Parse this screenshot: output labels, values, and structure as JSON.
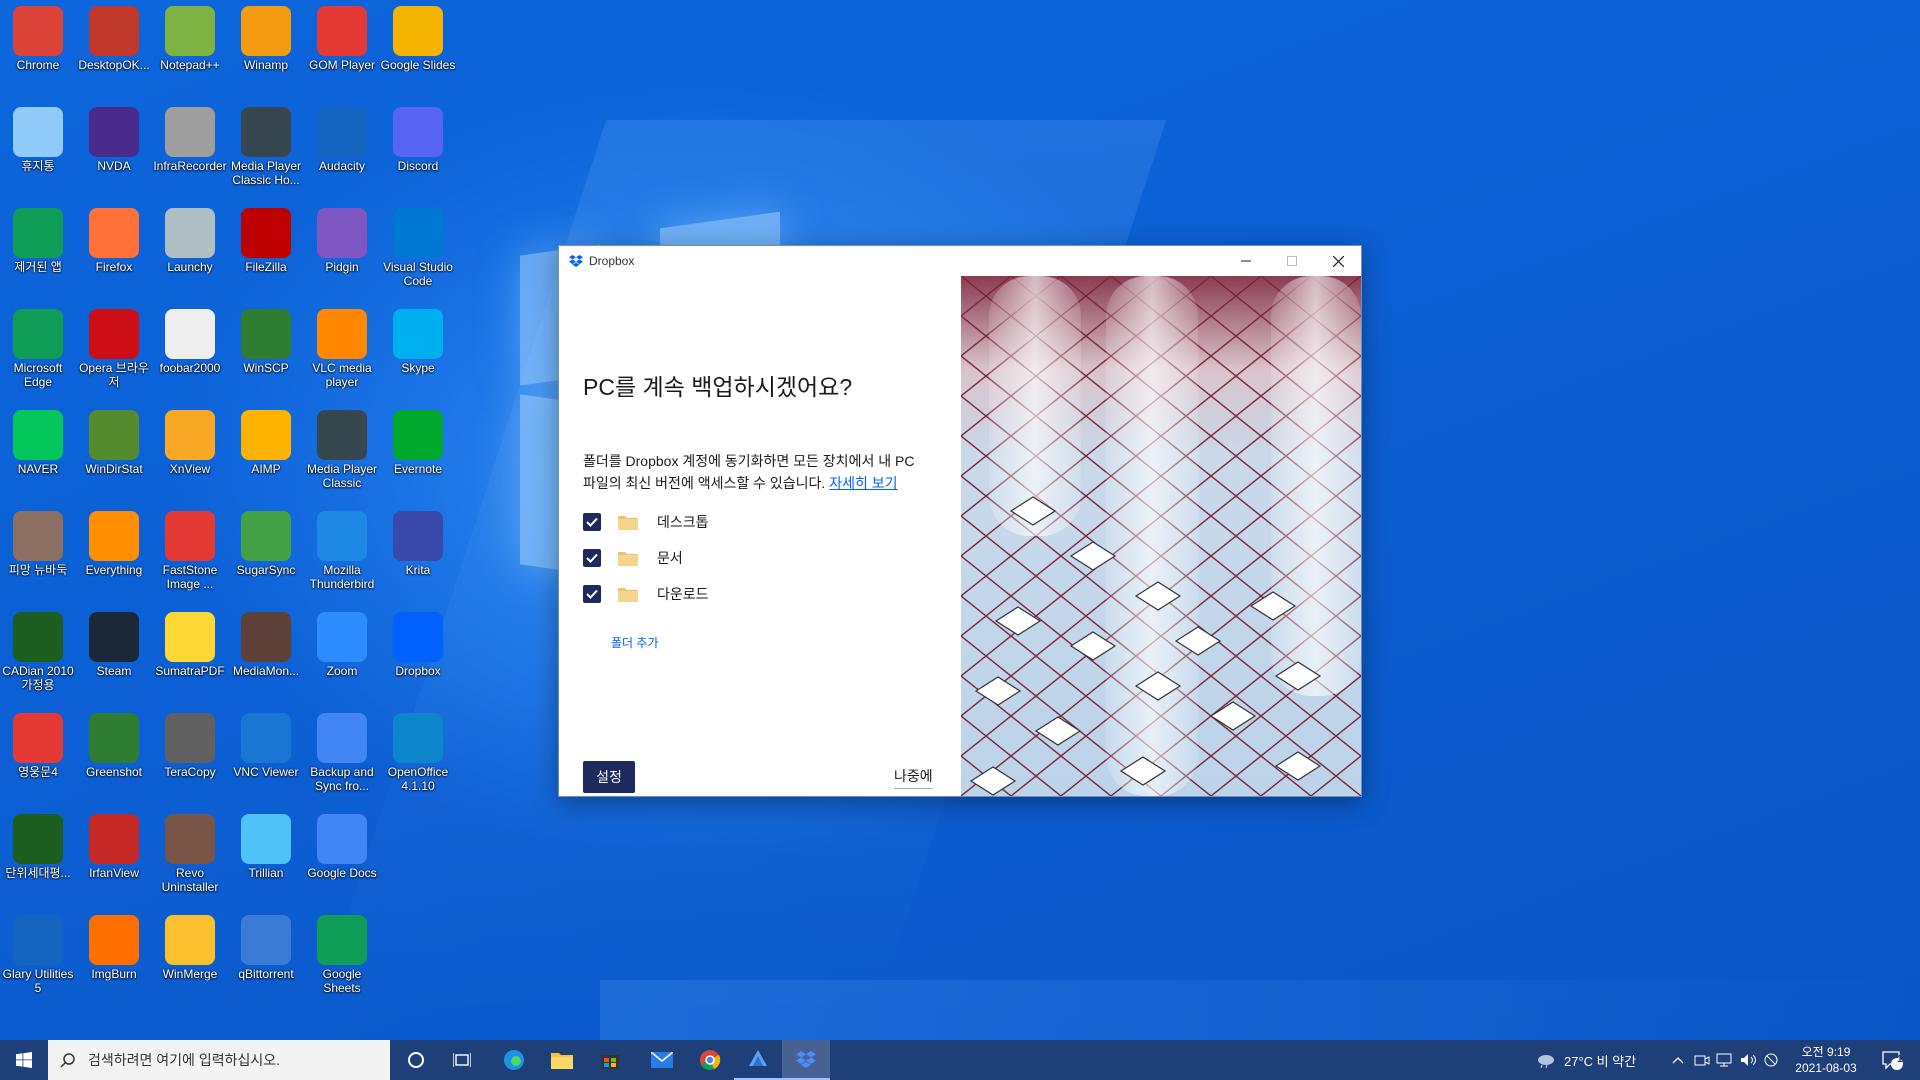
{
  "desktop": {
    "icons": [
      {
        "label": "Chrome",
        "icon": "chrome-icon",
        "color": "#db4437"
      },
      {
        "label": "DesktopOK...",
        "icon": "desktopok-icon",
        "color": "#c0392b"
      },
      {
        "label": "Notepad++",
        "icon": "notepadpp-icon",
        "color": "#7cb342"
      },
      {
        "label": "Winamp",
        "icon": "winamp-icon",
        "color": "#f39c12"
      },
      {
        "label": "GOM Player",
        "icon": "gom-player-icon",
        "color": "#e53935"
      },
      {
        "label": "Google Slides",
        "icon": "google-slides-icon",
        "color": "#f4b400"
      },
      {
        "label": "휴지통",
        "icon": "recycle-bin-icon",
        "color": "#90caf9"
      },
      {
        "label": "NVDA",
        "icon": "nvda-icon",
        "color": "#4a2a8c"
      },
      {
        "label": "InfraRecorder",
        "icon": "infrarecorder-icon",
        "color": "#9e9e9e"
      },
      {
        "label": "Media Player Classic Ho...",
        "icon": "mpc-hc-icon",
        "color": "#37474f"
      },
      {
        "label": "Audacity",
        "icon": "audacity-icon",
        "color": "#1565c0"
      },
      {
        "label": "Discord",
        "icon": "discord-icon",
        "color": "#5865f2"
      },
      {
        "label": "제거된 앱",
        "icon": "edge-removed-icon",
        "color": "#0f9d58"
      },
      {
        "label": "Firefox",
        "icon": "firefox-icon",
        "color": "#ff7139"
      },
      {
        "label": "Launchy",
        "icon": "launchy-icon",
        "color": "#b0bec5"
      },
      {
        "label": "FileZilla",
        "icon": "filezilla-icon",
        "color": "#bf0000"
      },
      {
        "label": "Pidgin",
        "icon": "pidgin-icon",
        "color": "#7e57c2"
      },
      {
        "label": "Visual Studio Code",
        "icon": "vscode-icon",
        "color": "#0078d4"
      },
      {
        "label": "Microsoft Edge",
        "icon": "edge-icon",
        "color": "#0f9d58"
      },
      {
        "label": "Opera 브라우저",
        "icon": "opera-icon",
        "color": "#cc0f16"
      },
      {
        "label": "foobar2000",
        "icon": "foobar-icon",
        "color": "#eeeeee"
      },
      {
        "label": "WinSCP",
        "icon": "winscp-icon",
        "color": "#2e7d32"
      },
      {
        "label": "VLC media player",
        "icon": "vlc-icon",
        "color": "#ff8800"
      },
      {
        "label": "Skype",
        "icon": "skype-icon",
        "color": "#00aff0"
      },
      {
        "label": "NAVER",
        "icon": "naver-icon",
        "color": "#03c75a"
      },
      {
        "label": "WinDirStat",
        "icon": "windirstat-icon",
        "color": "#558b2f"
      },
      {
        "label": "XnView",
        "icon": "xnview-icon",
        "color": "#f9a825"
      },
      {
        "label": "AIMP",
        "icon": "aimp-icon",
        "color": "#ffb300"
      },
      {
        "label": "Media Player Classic",
        "icon": "mpc-icon",
        "color": "#37474f"
      },
      {
        "label": "Evernote",
        "icon": "evernote-icon",
        "color": "#00a82d"
      },
      {
        "label": "피망 뉴바둑",
        "icon": "pmang-baduk-icon",
        "color": "#8d6e63"
      },
      {
        "label": "Everything",
        "icon": "everything-icon",
        "color": "#ff8f00"
      },
      {
        "label": "FastStone Image ...",
        "icon": "faststone-icon",
        "color": "#e53935"
      },
      {
        "label": "SugarSync",
        "icon": "sugarsync-icon",
        "color": "#43a047"
      },
      {
        "label": "Mozilla Thunderbird",
        "icon": "thunderbird-icon",
        "color": "#1e88e5"
      },
      {
        "label": "Krita",
        "icon": "krita-icon",
        "color": "#3949ab"
      },
      {
        "label": "CADian 2010 가정용",
        "icon": "cadian-icon",
        "color": "#1b5e20"
      },
      {
        "label": "Steam",
        "icon": "steam-icon",
        "color": "#1b2838"
      },
      {
        "label": "SumatraPDF",
        "icon": "sumatrapdf-icon",
        "color": "#fdd835"
      },
      {
        "label": "MediaMon...",
        "icon": "mediamonkey-icon",
        "color": "#5d4037"
      },
      {
        "label": "Zoom",
        "icon": "zoom-icon",
        "color": "#2d8cff"
      },
      {
        "label": "Dropbox",
        "icon": "dropbox-icon",
        "color": "#0061fe"
      },
      {
        "label": "영웅문4",
        "icon": "youngwoongmun-icon",
        "color": "#e53935"
      },
      {
        "label": "Greenshot",
        "icon": "greenshot-icon",
        "color": "#2e7d32"
      },
      {
        "label": "TeraCopy",
        "icon": "teracopy-icon",
        "color": "#616161"
      },
      {
        "label": "VNC Viewer",
        "icon": "vnc-viewer-icon",
        "color": "#1976d2"
      },
      {
        "label": "Backup and Sync fro...",
        "icon": "backup-sync-icon",
        "color": "#4285f4"
      },
      {
        "label": "OpenOffice 4.1.10",
        "icon": "openoffice-icon",
        "color": "#0e85cd"
      },
      {
        "label": "단위세대평...",
        "icon": "cadian-unit-icon",
        "color": "#1b5e20"
      },
      {
        "label": "IrfanView",
        "icon": "irfanview-icon",
        "color": "#c62828"
      },
      {
        "label": "Revo Uninstaller",
        "icon": "revo-uninstaller-icon",
        "color": "#795548"
      },
      {
        "label": "Trillian",
        "icon": "trillian-icon",
        "color": "#4fc3f7"
      },
      {
        "label": "Google Docs",
        "icon": "google-docs-icon",
        "color": "#4285f4"
      },
      {
        "label": "",
        "icon": "",
        "color": ""
      },
      {
        "label": "Glary Utilities 5",
        "icon": "glary-utilities-icon",
        "color": "#1565c0"
      },
      {
        "label": "ImgBurn",
        "icon": "imgburn-icon",
        "color": "#ff6f00"
      },
      {
        "label": "WinMerge",
        "icon": "winmerge-icon",
        "color": "#fbc02d"
      },
      {
        "label": "qBittorrent",
        "icon": "qbittorrent-icon",
        "color": "#3a7bd5"
      },
      {
        "label": "Google Sheets",
        "icon": "google-sheets-icon",
        "color": "#0f9d58"
      }
    ]
  },
  "dialog": {
    "app_name": "Dropbox",
    "heading": "PC를 계속 백업하시겠어요?",
    "description": "폴더를 Dropbox 계정에 동기화하면 모든 장치에서 내 PC 파일의 최신 버전에 액세스할 수 있습니다.",
    "learn_more": "자세히 보기",
    "folders": [
      {
        "label": "데스크톱",
        "checked": true
      },
      {
        "label": "문서",
        "checked": true
      },
      {
        "label": "다운로드",
        "checked": true
      }
    ],
    "add_folder": "폴더 추가",
    "setup_button": "설정",
    "later_button": "나중에",
    "accent": "#1e2a5e",
    "link_color": "#0061fe"
  },
  "taskbar": {
    "search_placeholder": "검색하려면 여기에 입력하십시오.",
    "weather": "27°C  비 약간",
    "time": "오전 9:19",
    "date": "2021-08-03",
    "notification_count": "12",
    "pinned": [
      "edge-icon",
      "file-explorer-icon",
      "store-icon",
      "mail-icon",
      "chrome-icon",
      "app-icon",
      "dropbox-icon"
    ]
  }
}
